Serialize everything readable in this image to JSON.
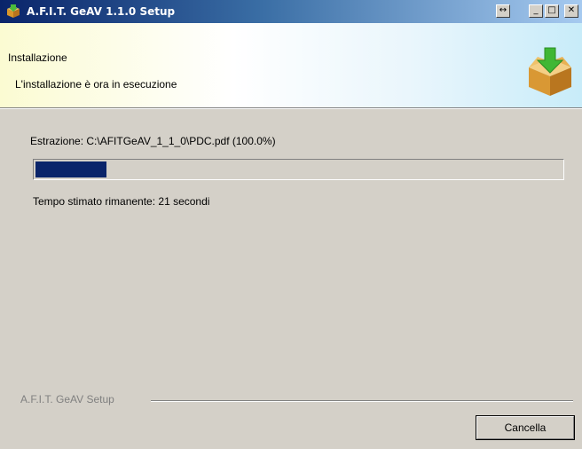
{
  "window": {
    "title": "A.F.I.T. GeAV 1.1.0 Setup",
    "buttons": {
      "resize": "↔",
      "minimize": "_",
      "maximize": "□",
      "close": "✕"
    }
  },
  "header": {
    "title": "Installazione",
    "subtitle": "L'installazione è ora in esecuzione",
    "icon": "install-box-icon"
  },
  "body": {
    "status": "Estrazione: C:\\AFITGeAV_1_1_0\\PDC.pdf (100.0%)",
    "progress_fraction": 0.135,
    "remaining": "Tempo stimato rimanente: 21 secondi"
  },
  "footer": {
    "brand": "A.F.I.T. GeAV Setup",
    "cancel_label": "Cancella"
  },
  "colors": {
    "title_bar_start": "#0a246a",
    "title_bar_end": "#a6caf0",
    "progress_fill": "#0a246a",
    "window_bg": "#d4d0c8"
  }
}
